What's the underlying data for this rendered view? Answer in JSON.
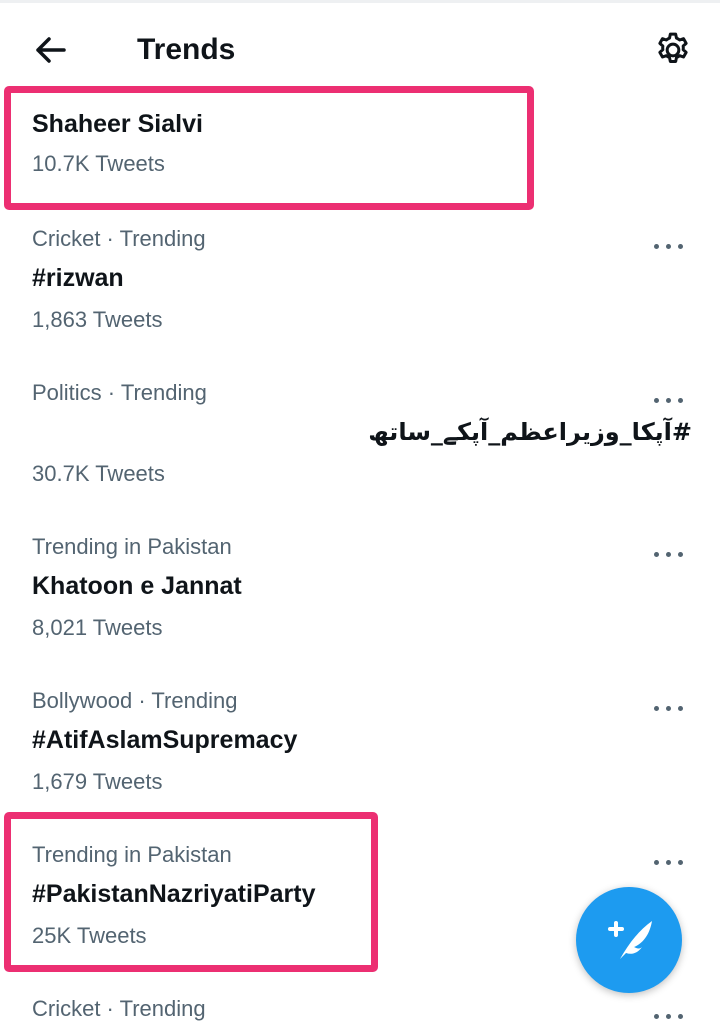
{
  "header": {
    "title": "Trends"
  },
  "trends": [
    {
      "meta": "",
      "name": "Shaheer Sialvi",
      "count": "10.7K Tweets"
    },
    {
      "meta": "Cricket · Trending",
      "name": "#rizwan",
      "count": "1,863 Tweets"
    },
    {
      "meta": "Politics · Trending",
      "name": "#آپکا_وزیراعظم_آپکے_ساتھ",
      "count": "30.7K Tweets"
    },
    {
      "meta": "Trending in Pakistan",
      "name": "Khatoon e Jannat",
      "count": "8,021 Tweets"
    },
    {
      "meta": "Bollywood · Trending",
      "name": "#AtifAslamSupremacy",
      "count": "1,679 Tweets"
    },
    {
      "meta": "Trending in Pakistan",
      "name": "#PakistanNazriyatiParty",
      "count": "25K Tweets"
    },
    {
      "meta": "Cricket · Trending",
      "name": "",
      "count": ""
    }
  ],
  "colors": {
    "accent": "#1d9bf0",
    "highlight": "#ec2f72",
    "secondary_text": "#536471"
  },
  "icons": {
    "back": "arrow-left-icon",
    "settings": "gear-icon",
    "more": "more-horizontal-icon",
    "compose": "compose-tweet-icon"
  }
}
